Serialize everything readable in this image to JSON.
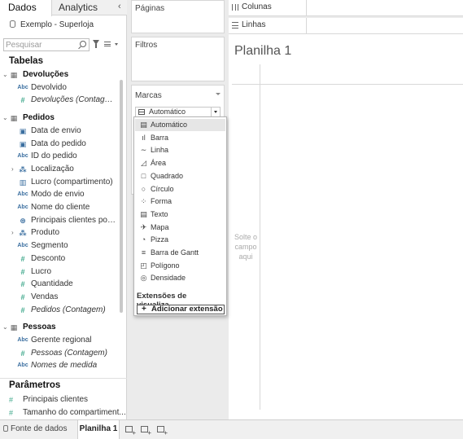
{
  "left_pane": {
    "tabs": [
      "Dados",
      "Analytics"
    ],
    "collapse_glyph": "‹",
    "datasource": "Exemplo - Superloja",
    "search": {
      "placeholder": "Pesquisar",
      "icon": "search-icon"
    },
    "section_tables": "Tabelas",
    "section_params": "Parâmetros",
    "fields": [
      {
        "label": "Devoluções",
        "icon": "table-icon",
        "type": "group",
        "expander": "⌄"
      },
      {
        "label": "Devolvido",
        "icon": "Abc",
        "type": "dim"
      },
      {
        "label": "Devoluções (Contage...",
        "icon": "#",
        "type": "measure-italic"
      },
      {
        "label": "Pedidos",
        "icon": "table-icon",
        "type": "group",
        "expander": "⌄"
      },
      {
        "label": "Data de envio",
        "icon": "calendar-icon",
        "type": "dim"
      },
      {
        "label": "Data do pedido",
        "icon": "calendar-icon",
        "type": "dim"
      },
      {
        "label": "ID do pedido",
        "icon": "Abc",
        "type": "dim"
      },
      {
        "label": "Localização",
        "icon": "hierarchy-icon",
        "type": "dim",
        "expander": "›"
      },
      {
        "label": "Lucro (compartimento)",
        "icon": "bin-icon",
        "type": "dim"
      },
      {
        "label": "Modo de envio",
        "icon": "Abc",
        "type": "dim"
      },
      {
        "label": "Nome do cliente",
        "icon": "Abc",
        "type": "dim"
      },
      {
        "label": "Principais clientes por...",
        "icon": "set-icon",
        "type": "dim"
      },
      {
        "label": "Produto",
        "icon": "hierarchy-icon",
        "type": "dim",
        "expander": "›"
      },
      {
        "label": "Segmento",
        "icon": "Abc",
        "type": "dim"
      },
      {
        "label": "Desconto",
        "icon": "#",
        "type": "measure"
      },
      {
        "label": "Lucro",
        "icon": "#",
        "type": "measure"
      },
      {
        "label": "Quantidade",
        "icon": "#",
        "type": "measure"
      },
      {
        "label": "Vendas",
        "icon": "#",
        "type": "measure"
      },
      {
        "label": "Pedidos (Contagem)",
        "icon": "#",
        "type": "measure-italic"
      },
      {
        "label": "Pessoas",
        "icon": "table-icon",
        "type": "group",
        "expander": "⌄"
      },
      {
        "label": "Gerente regional",
        "icon": "Abc",
        "type": "dim"
      },
      {
        "label": "Pessoas (Contagem)",
        "icon": "#",
        "type": "measure-italic"
      },
      {
        "label": "Nomes de medida",
        "icon": "Abc",
        "type": "measure-italic"
      }
    ],
    "parameters": [
      {
        "label": "Principais clientes",
        "icon": "#"
      },
      {
        "label": "Tamanho do compartiment...",
        "icon": "#"
      }
    ]
  },
  "cards": {
    "paginas": "Páginas",
    "filtros": "Filtros",
    "marcas": "Marcas",
    "mark_type_selected": "Automático"
  },
  "shelves": {
    "colunas": "Colunas",
    "linhas": "Linhas"
  },
  "view": {
    "sheet_title": "Planilha 1",
    "drop_text": "Solte o campo aqui"
  },
  "mark_menu": {
    "items": [
      {
        "label": "Automático",
        "icon": "▤",
        "selected": true
      },
      {
        "label": "Barra",
        "icon": "ıl"
      },
      {
        "label": "Linha",
        "icon": "∼"
      },
      {
        "label": "Área",
        "icon": "◿"
      },
      {
        "label": "Quadrado",
        "icon": "□"
      },
      {
        "label": "Círculo",
        "icon": "○"
      },
      {
        "label": "Forma",
        "icon": "⁘"
      },
      {
        "label": "Texto",
        "icon": "▤"
      },
      {
        "label": "Mapa",
        "icon": "✈"
      },
      {
        "label": "Pizza",
        "icon": "◔"
      },
      {
        "label": "Barra de Gantt",
        "icon": "≡"
      },
      {
        "label": "Polígono",
        "icon": "◰"
      },
      {
        "label": "Densidade",
        "icon": "◎"
      }
    ],
    "extensions_heading": "Extensões de visualiza...",
    "add_extension": "Adicionar extensão"
  },
  "bottom_bar": {
    "datasource_tab": "Fonte de dados",
    "sheet_tab": "Planilha 1"
  }
}
